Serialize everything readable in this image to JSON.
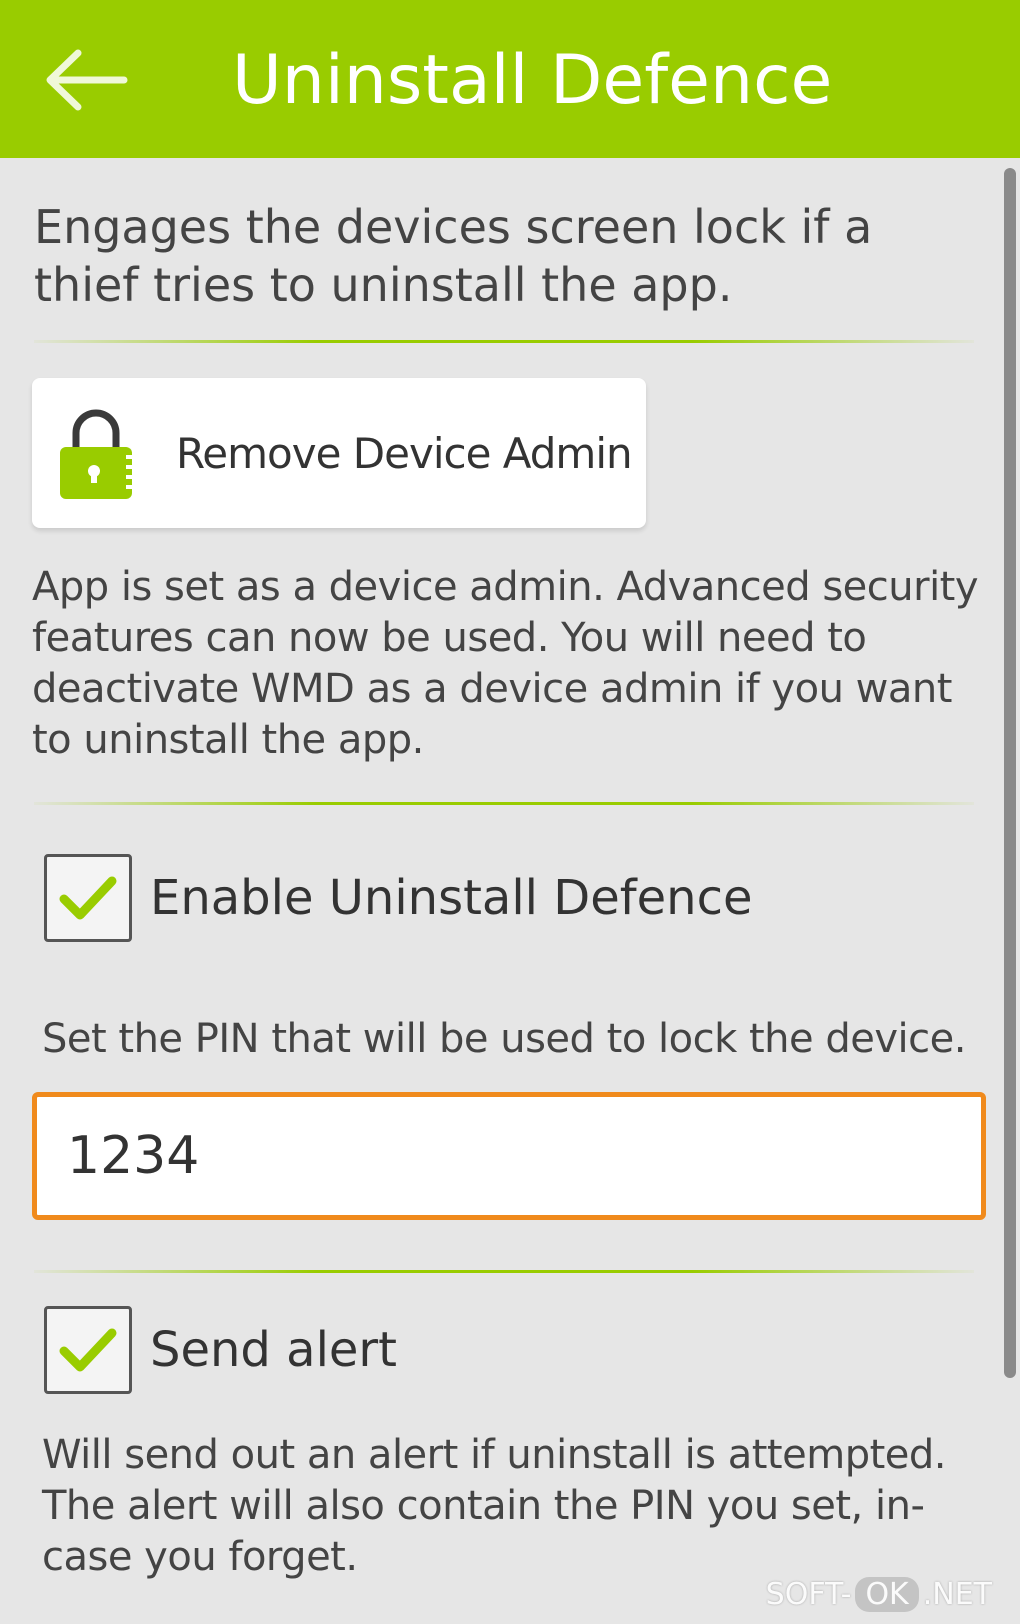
{
  "colors": {
    "header_bg": "#99cc00",
    "accent_green": "#99cc00",
    "input_focus_border": "#f08a1c",
    "background": "#e6e6e6"
  },
  "header": {
    "back_icon": "back-arrow-icon",
    "title": "Uninstall Defence"
  },
  "intro_text": "Engages the devices screen lock if a thief tries to uninstall the app.",
  "admin_button": {
    "icon": "lock-icon",
    "label": "Remove Device Admin"
  },
  "admin_description": "App is set as a device admin. Advanced security features can now be used. You will need to deactivate WMD as a device admin if you want to uninstall the app.",
  "enable_option": {
    "label": "Enable Uninstall Defence",
    "checked": true
  },
  "pin": {
    "description": "Set the PIN that will be used to lock the device.",
    "value": "1234"
  },
  "alert_option": {
    "label": "Send alert",
    "checked": true
  },
  "alert_description": "Will send out an alert if uninstall is attempted. The alert will also contain the PIN you set, in-case you forget.",
  "watermark": {
    "left": "SOFT-",
    "middle": "OK",
    "right": ".NET"
  }
}
